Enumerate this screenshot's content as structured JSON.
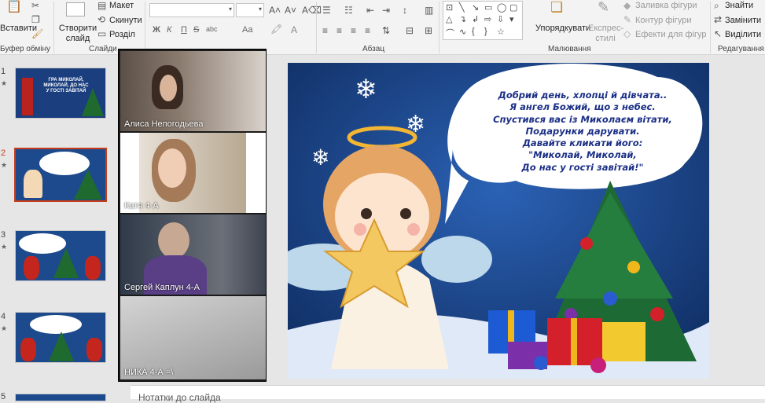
{
  "ribbon": {
    "clipboard": {
      "paste_label": "Вставити",
      "group_label": "Буфер обміну"
    },
    "slides": {
      "new_slide_label": "Створити слайд",
      "layout_label": "Макет",
      "reset_label": "Скинути",
      "section_label": "Розділ",
      "group_label": "Слайди"
    },
    "font": {
      "bold": "Ж",
      "italic": "К",
      "underline": "П",
      "strike": "S",
      "spacing": "abc",
      "case": "Aa"
    },
    "paragraph": {
      "group_label": "Абзац"
    },
    "drawing": {
      "arrange_label": "Упорядкувати",
      "quick_styles_label": "Експрес-стилі",
      "fill_label": "Заливка фігури",
      "outline_label": "Контур фігури",
      "effects_label": "Ефекти для фігур",
      "group_label": "Малювання"
    },
    "editing": {
      "find_label": "Знайти",
      "replace_label": "Замінити",
      "select_label": "Виділити",
      "group_label": "Редагування"
    }
  },
  "thumbnails": [
    {
      "number": "1",
      "title": "ГРА МИКОЛАЙ, МИКОЛАЙ, ДО НАС У ГОСТІ ЗАВІТАЙ"
    },
    {
      "number": "2",
      "title": ""
    },
    {
      "number": "3",
      "title": ""
    },
    {
      "number": "4",
      "title": ""
    },
    {
      "number": "5",
      "title": ""
    }
  ],
  "participants": [
    {
      "name": "Алиса Непогодьева"
    },
    {
      "name": "Катя 4-А"
    },
    {
      "name": "Сергей Каплун 4-А"
    },
    {
      "name": "НИКА 4-А =\\"
    }
  ],
  "slide": {
    "bubble_lines": [
      "Добрий день, хлопці й дівчата..",
      "Я ангел Божий, що з небес.",
      "Спустився вас із Миколаєм вітати,",
      "Подарунки дарувати.",
      "Давайте кликати його:",
      "\"Миколай, Миколай,",
      "До нас у гості завітай!\""
    ]
  },
  "notes": {
    "placeholder": "Нотатки до слайда"
  },
  "colors": {
    "selected_border": "#c43e1c",
    "slide_bg": "#1c4688",
    "bubble_text": "#1b2f86"
  }
}
